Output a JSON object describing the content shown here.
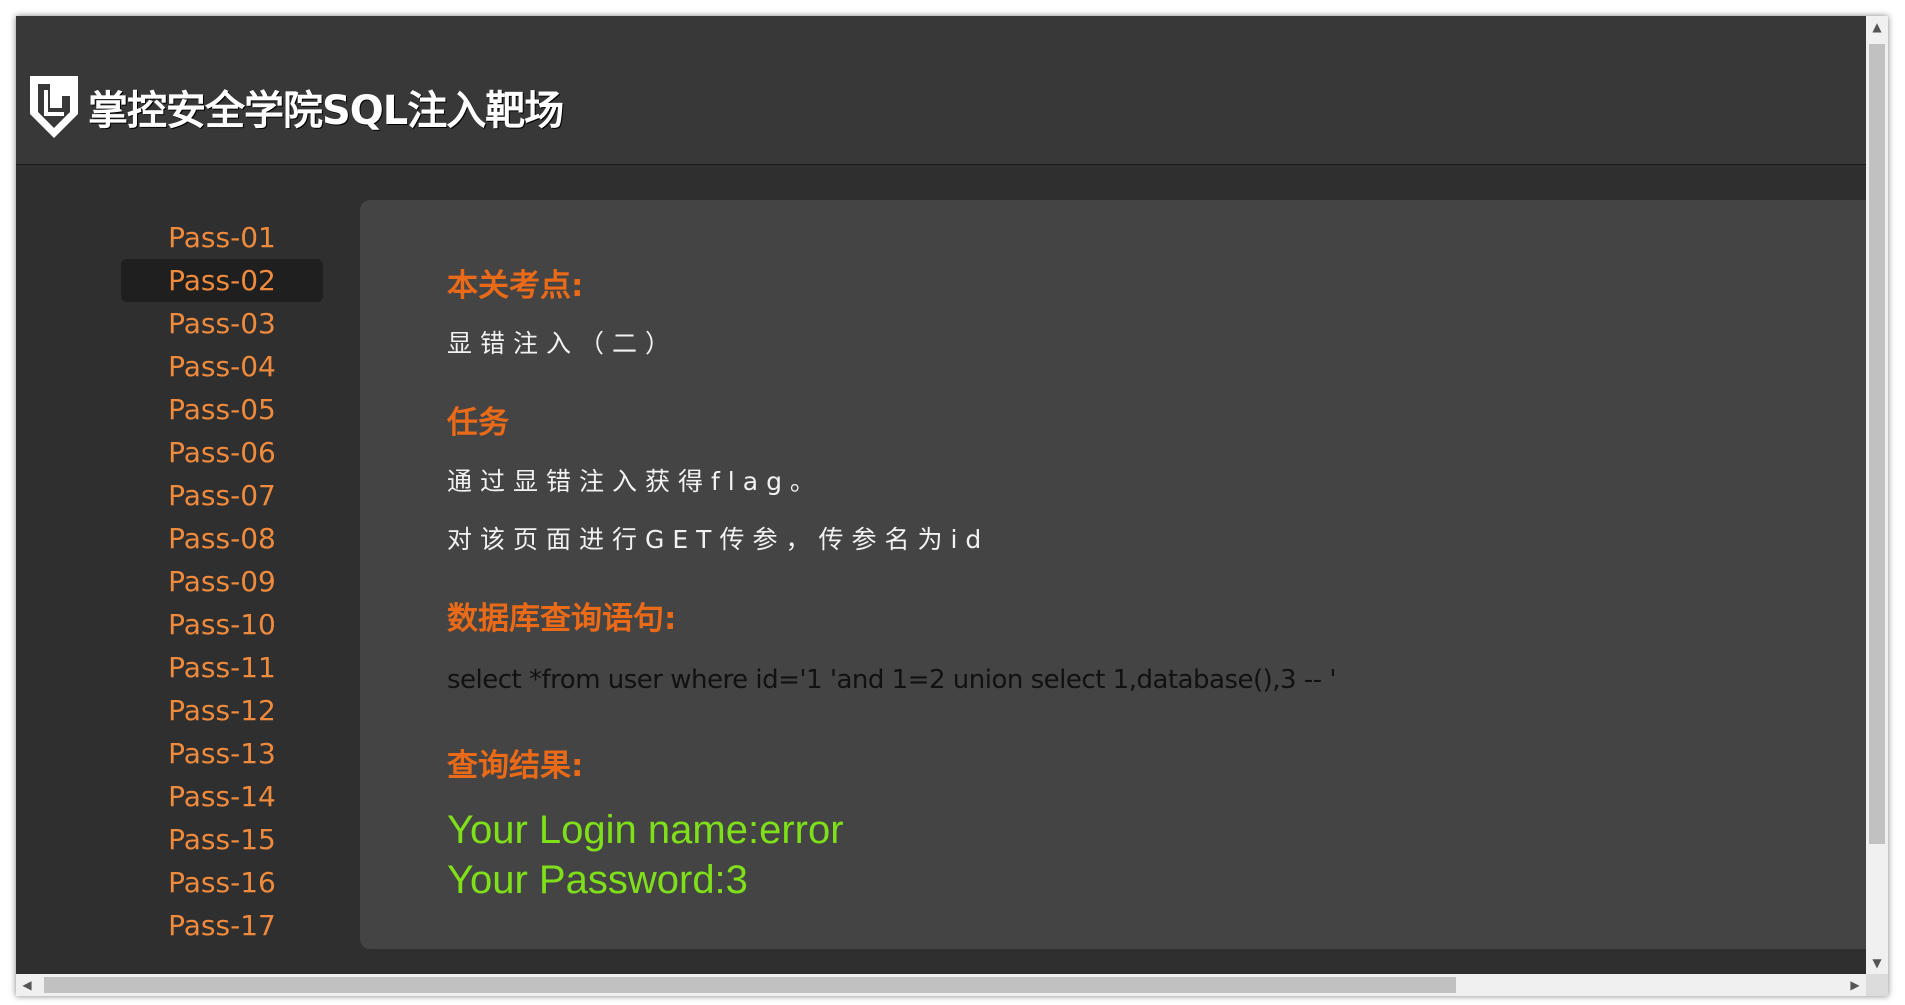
{
  "header": {
    "logo_text": "掌控安全学院SQL注入靶场"
  },
  "sidebar": {
    "items": [
      {
        "label": "Pass-01"
      },
      {
        "label": "Pass-02",
        "active": true
      },
      {
        "label": "Pass-03"
      },
      {
        "label": "Pass-04"
      },
      {
        "label": "Pass-05"
      },
      {
        "label": "Pass-06"
      },
      {
        "label": "Pass-07"
      },
      {
        "label": "Pass-08"
      },
      {
        "label": "Pass-09"
      },
      {
        "label": "Pass-10"
      },
      {
        "label": "Pass-11"
      },
      {
        "label": "Pass-12"
      },
      {
        "label": "Pass-13"
      },
      {
        "label": "Pass-14"
      },
      {
        "label": "Pass-15"
      },
      {
        "label": "Pass-16"
      },
      {
        "label": "Pass-17"
      }
    ]
  },
  "main": {
    "topic_heading": "本关考点:",
    "topic_text": "显错注入（二）",
    "task_heading": "任务",
    "task_line1": "通过显错注入获得flag。",
    "task_line2": "对该页面进行GET传参，传参名为id",
    "query_heading": "数据库查询语句:",
    "query_text": "select *from user where id='1 'and 1=2 union select 1,database(),3 -- '",
    "result_heading": "查询结果:",
    "result_line1": "Your Login name:error",
    "result_line2": "Your Password:3"
  },
  "colors": {
    "accent_orange": "#ea6a18",
    "link_orange": "#f08a3c",
    "result_green": "#7fe01a"
  }
}
